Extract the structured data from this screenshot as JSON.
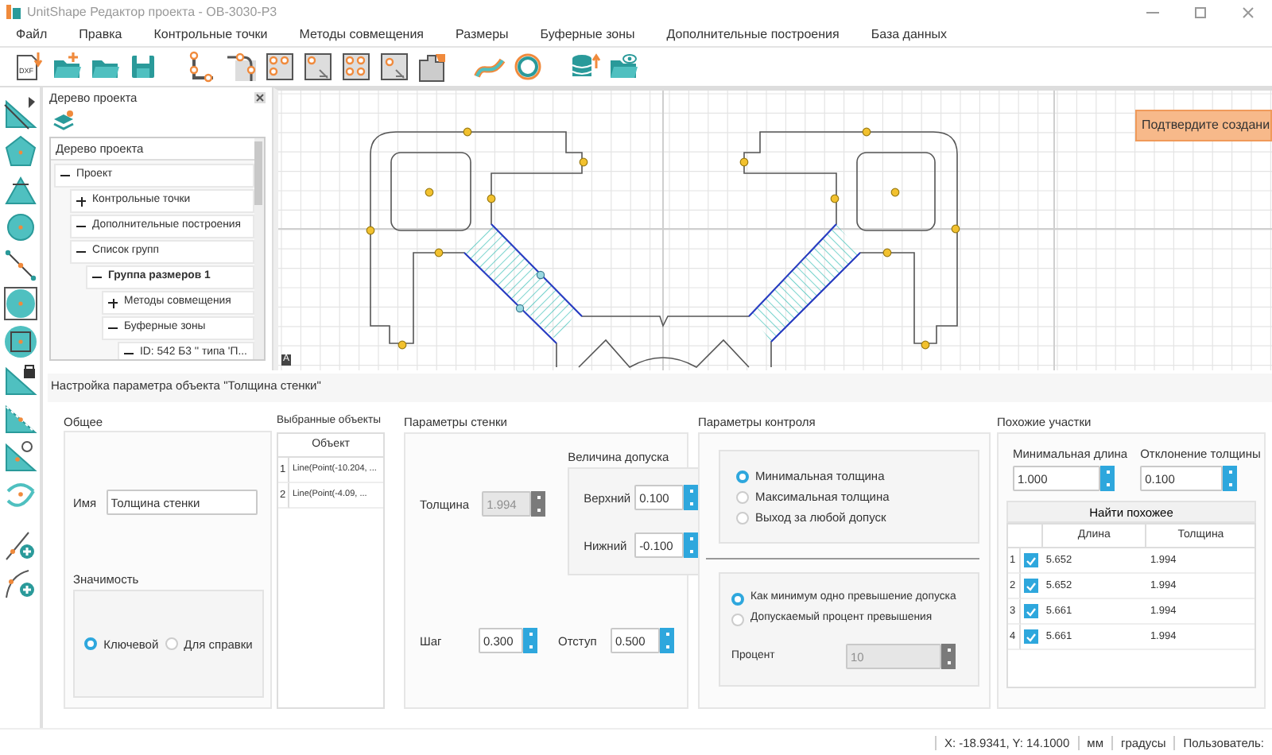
{
  "window": {
    "title": "UnitShape Редактор проекта - ОВ-3030-Р3"
  },
  "menu": [
    "Файл",
    "Правка",
    "Контрольные точки",
    "Методы совмещения",
    "Размеры",
    "Буферные зоны",
    "Дополнительные построения",
    "База данных"
  ],
  "toolbar": {
    "import_label": "DXF"
  },
  "project_tree": {
    "title": "Дерево проекта",
    "header": "Дерево проекта",
    "items": [
      {
        "label": "Проект",
        "expanded": true,
        "selected": false,
        "children": [
          {
            "label": "Контрольные точки",
            "expanded": false,
            "selected": false
          },
          {
            "label": "Дополнительные построения",
            "expanded": true,
            "selected": false
          },
          {
            "label": "Список групп",
            "expanded": true,
            "selected": false,
            "children": [
              {
                "label": "Группа размеров 1",
                "expanded": true,
                "selected": true,
                "children": [
                  {
                    "label": "Методы совмещения",
                    "expanded": false,
                    "selected": false
                  },
                  {
                    "label": "Буферные зоны",
                    "expanded": true,
                    "selected": false,
                    "children": [
                      {
                        "label": "ID: 542 Б3 '' типа 'П...",
                        "expanded": true,
                        "selected": false
                      }
                    ]
                  }
                ]
              }
            ]
          }
        ]
      }
    ]
  },
  "canvas": {
    "corner_mark": "A",
    "notification": "Подтвердите создани"
  },
  "settings": {
    "title": "Настройка параметра объекта \"Толщина стенки\"",
    "general": {
      "title": "Общее",
      "name_label": "Имя",
      "name_value": "Толщина стенки",
      "importance": {
        "title": "Значимость",
        "options": [
          {
            "label": "Ключевой",
            "selected": true
          },
          {
            "label": "Для справки",
            "selected": false
          }
        ]
      }
    },
    "selected_objects": {
      "title": "Выбранные объекты",
      "column": "Объект",
      "rows": [
        {
          "index": "1",
          "object": "Line(Point(-10.204, ..."
        },
        {
          "index": "2",
          "object": "Line(Point(-4.09, ..."
        }
      ]
    },
    "wall": {
      "title": "Параметры стенки",
      "thickness": {
        "label": "Толщина",
        "value": "1.994",
        "disabled": true
      },
      "tolerance": {
        "title": "Величина допуска",
        "upper": {
          "label": "Верхний",
          "value": "0.100",
          "disabled": false
        },
        "lower": {
          "label": "Нижний",
          "value": "-0.100",
          "disabled": false
        }
      },
      "step": {
        "label": "Шаг",
        "value": "0.300",
        "disabled": false
      },
      "offset": {
        "label": "Отступ",
        "value": "0.500",
        "disabled": false
      }
    },
    "control": {
      "title": "Параметры контроля",
      "mode": [
        {
          "label": "Минимальная толщина",
          "selected": true
        },
        {
          "label": "Максимальная толщина",
          "selected": false
        },
        {
          "label": "Выход за любой допуск",
          "selected": false
        }
      ],
      "violation": [
        {
          "label": "Как минимум одно превышение допуска",
          "selected": true
        },
        {
          "label": "Допускаемый процент превышения",
          "selected": false
        }
      ],
      "percent": {
        "label": "Процент",
        "value": "10",
        "disabled": true
      }
    },
    "similar": {
      "title": "Похожие участки",
      "min_length": {
        "label": "Минимальная длина",
        "value": "1.000",
        "disabled": false
      },
      "deviation": {
        "label": "Отклонение толщины",
        "value": "0.100",
        "disabled": false
      },
      "find_button": "Найти похожее",
      "columns": [
        "Длина",
        "Толщина"
      ],
      "rows": [
        {
          "index": "1",
          "checked": true,
          "length": "5.652",
          "thickness": "1.994"
        },
        {
          "index": "2",
          "checked": true,
          "length": "5.652",
          "thickness": "1.994"
        },
        {
          "index": "3",
          "checked": true,
          "length": "5.661",
          "thickness": "1.994"
        },
        {
          "index": "4",
          "checked": true,
          "length": "5.661",
          "thickness": "1.994"
        }
      ]
    }
  },
  "status_bar": [
    "X: -18.9341, Y: 14.1000",
    "мм",
    "градусы",
    "Пользователь:"
  ]
}
